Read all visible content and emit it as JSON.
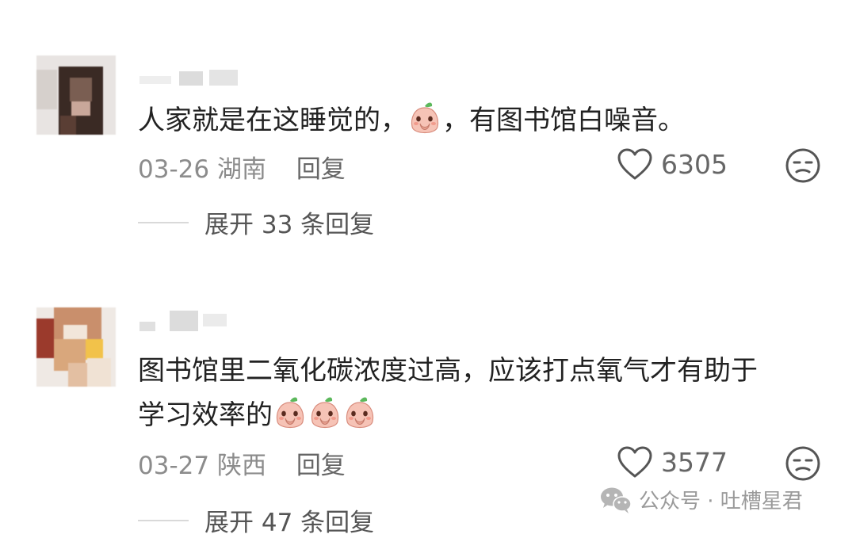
{
  "comments": [
    {
      "text_before": "人家就是在这睡觉的，",
      "emoji": "peach-covering-mouth-emoji",
      "text_after": "，有图书馆白噪音。",
      "date": "03-26",
      "location": "湖南",
      "reply_label": "回复",
      "likes": "6305",
      "expand_label": "展开 33 条回复"
    },
    {
      "text_line1": "图书馆里二氧化碳浓度过高，应该打点氧气才有助于",
      "text_line2": "学习效率的",
      "emoji": "peach-covering-mouth-emoji",
      "emoji_count": 3,
      "date": "03-27",
      "location": "陕西",
      "reply_label": "回复",
      "likes": "3577",
      "expand_label": "展开 47 条回复"
    }
  ],
  "watermark": {
    "icon": "wechat-icon",
    "text": "公众号 · 吐槽星君"
  },
  "colors": {
    "text": "#222222",
    "meta": "#8c8c8c",
    "icon": "#555555",
    "emoji_body": "#f6c3b6",
    "emoji_leaf": "#5cb85c"
  }
}
